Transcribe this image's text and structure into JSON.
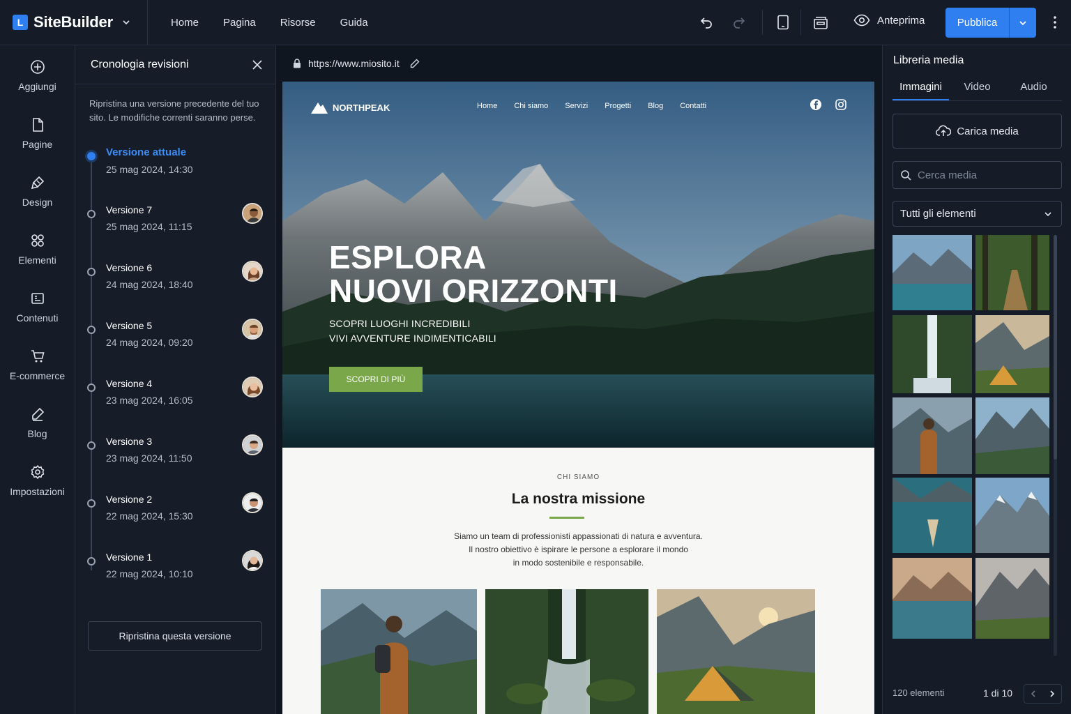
{
  "app": {
    "name": "SiteBuilder",
    "logo_letter": "L"
  },
  "top_nav": [
    "Home",
    "Pagina",
    "Risorse",
    "Guida"
  ],
  "toolbar": {
    "preview_label": "Anteprima",
    "publish_label": "Pubblica"
  },
  "rail": [
    {
      "label": "Aggiungi",
      "icon": "plus-circle-icon"
    },
    {
      "label": "Pagine",
      "icon": "page-icon"
    },
    {
      "label": "Design",
      "icon": "brush-icon"
    },
    {
      "label": "Elementi",
      "icon": "grid-icon"
    },
    {
      "label": "Contenuti",
      "icon": "content-icon"
    },
    {
      "label": "E-commerce",
      "icon": "cart-icon"
    },
    {
      "label": "Blog",
      "icon": "pen-icon"
    },
    {
      "label": "Impostazioni",
      "icon": "gear-icon"
    }
  ],
  "history": {
    "title": "Cronologia revisioni",
    "description": "Ripristina una versione precedente del tuo sito. Le modifiche correnti saranno perse.",
    "versions": [
      {
        "name": "Versione attuale",
        "date": "25 mag 2024, 14:30",
        "current": true
      },
      {
        "name": "Versione 7",
        "date": "25 mag 2024, 11:15"
      },
      {
        "name": "Versione 6",
        "date": "24 mag 2024, 18:40"
      },
      {
        "name": "Versione 5",
        "date": "24 mag 2024, 09:20"
      },
      {
        "name": "Versione 4",
        "date": "23 mag 2024, 16:05"
      },
      {
        "name": "Versione 3",
        "date": "23 mag 2024, 11:50"
      },
      {
        "name": "Versione 2",
        "date": "22 mag 2024, 15:30"
      },
      {
        "name": "Versione 1",
        "date": "22 mag 2024, 10:10"
      }
    ],
    "restore_label": "Ripristina questa versione"
  },
  "canvas": {
    "url": "https://www.miosito.it",
    "site": {
      "brand": "NORTHPEAK",
      "menu": [
        "Home",
        "Chi siamo",
        "Servizi",
        "Progetti",
        "Blog",
        "Contatti"
      ],
      "hero_title_1": "ESPLORA",
      "hero_title_2": "NUOVI ORIZZONTI",
      "hero_sub_1": "SCOPRI LUOGHI INCREDIBILI",
      "hero_sub_2": "VIVI AVVENTURE INDIMENTICABILI",
      "hero_cta": "SCOPRI DI PIÙ",
      "about_eyebrow": "CHI SIAMO",
      "about_title": "La nostra missione",
      "about_line_1": "Siamo un team di professionisti appassionati di natura e avventura.",
      "about_line_2": "Il nostro obiettivo è ispirare le persone a esplorare il mondo",
      "about_line_3": "in modo sostenibile e responsabile.",
      "accent": "#7aa74a"
    }
  },
  "media": {
    "title": "Libreria media",
    "tabs": [
      "Immagini",
      "Video",
      "Audio"
    ],
    "upload_label": "Carica media",
    "search_placeholder": "Cerca media",
    "filter_value": "Tutti gli elementi",
    "count": "120 elementi",
    "page": "1 di 10"
  },
  "colors": {
    "accent": "#2f7ff0",
    "bg": "#111722",
    "panel": "#151c27"
  }
}
